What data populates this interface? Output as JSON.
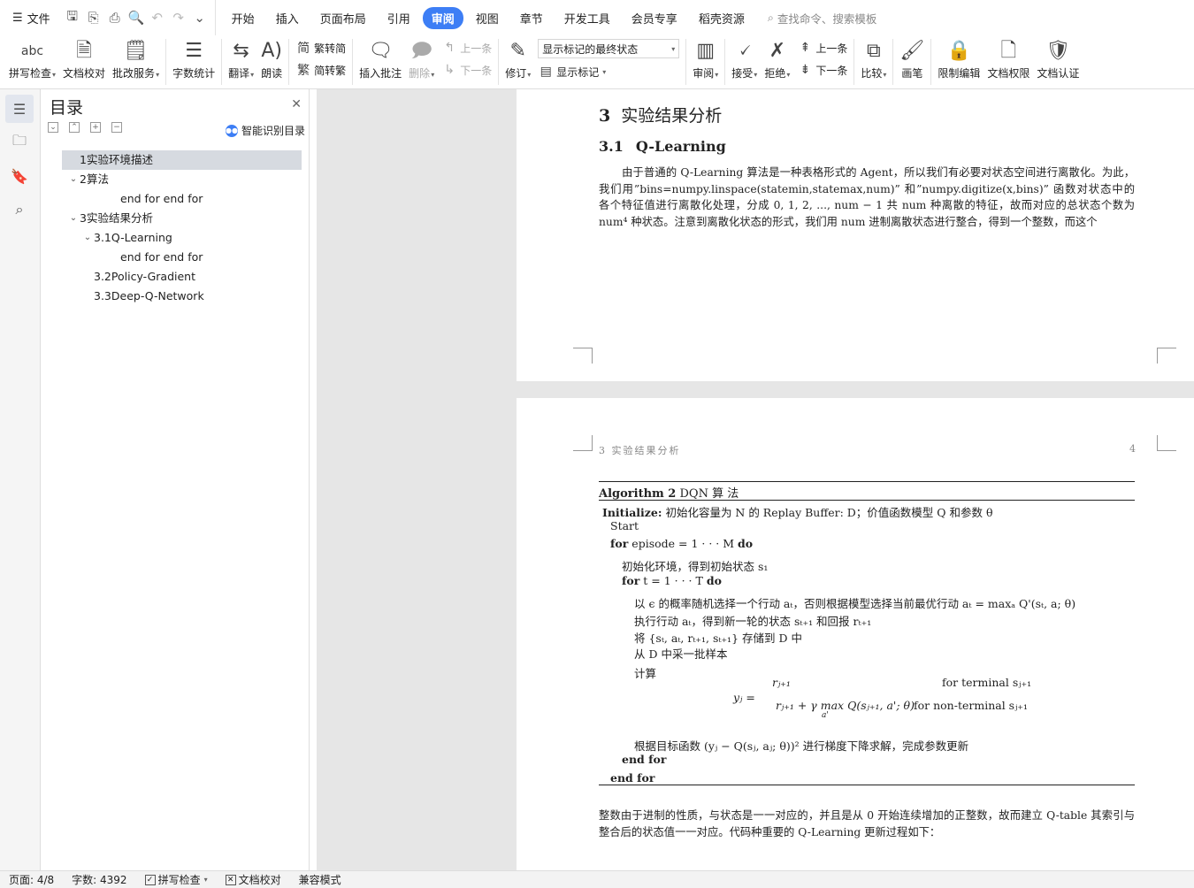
{
  "quick_access": {
    "file_label": "文件",
    "menu_icon": "hamburger-menu-icon"
  },
  "tabs": [
    {
      "label": "开始",
      "active": false
    },
    {
      "label": "插入",
      "active": false
    },
    {
      "label": "页面布局",
      "active": false
    },
    {
      "label": "引用",
      "active": false
    },
    {
      "label": "审阅",
      "active": true
    },
    {
      "label": "视图",
      "active": false
    },
    {
      "label": "章节",
      "active": false
    },
    {
      "label": "开发工具",
      "active": false
    },
    {
      "label": "会员专享",
      "active": false
    },
    {
      "label": "稻壳资源",
      "active": false
    }
  ],
  "command_search": {
    "placeholder": "查找命令、搜索模板"
  },
  "ribbon": {
    "spell_check": "拼写检查",
    "doc_proof": "文档校对",
    "correction_service": "批改服务",
    "word_count": "字数统计",
    "translate": "翻译",
    "read_aloud": "朗读",
    "trad_to_simp": "繁转简",
    "simp_to_trad": "简转繁",
    "insert_comment": "插入批注",
    "delete": "删除",
    "prev_comment": "上一条",
    "next_comment": "下一条",
    "revise": "修订",
    "markup_select": "显示标记的最终状态",
    "show_markup": "显示标记",
    "review": "审阅",
    "accept": "接受",
    "reject": "拒绝",
    "prev_change": "上一条",
    "next_change": "下一条",
    "compare": "比较",
    "brush": "画笔",
    "restrict_edit": "限制编辑",
    "doc_permission": "文档权限",
    "doc_certify": "文档认证",
    "abc_label": "abc"
  },
  "toc": {
    "title": "目录",
    "smart_label": "智能识别目录",
    "items": [
      {
        "label": "1实验环境描述",
        "level": 1,
        "selected": true,
        "expandable": false
      },
      {
        "label": "2算法",
        "level": 1,
        "selected": false,
        "expandable": true
      },
      {
        "label": "end for end for",
        "level": 3,
        "selected": false,
        "expandable": false
      },
      {
        "label": "3实验结果分析",
        "level": 1,
        "selected": false,
        "expandable": true
      },
      {
        "label": "3.1Q-Learning",
        "level": 2,
        "selected": false,
        "expandable": true
      },
      {
        "label": "end for end for",
        "level": 3,
        "selected": false,
        "expandable": false
      },
      {
        "label": "3.2Policy-Gradient",
        "level": 2,
        "selected": false,
        "expandable": false
      },
      {
        "label": "3.3Deep-Q-Network",
        "level": 2,
        "selected": false,
        "expandable": false
      }
    ]
  },
  "doc": {
    "page1": {
      "h1_num": "3",
      "h1_text": "实验结果分析",
      "h2_num": "3.1",
      "h2_text": "Q-Learning",
      "para": "由于普通的 Q-Learning 算法是一种表格形式的 Agent，所以我们有必要对状态空间进行离散化。为此，我们用”bins=numpy.linspace(statemin,statemax,num)” 和”numpy.digitize(x,bins)” 函数对状态中的各个特征值进行离散化处理，分成 0, 1, 2, ..., num − 1 共 num 种离散的特征，故而对应的总状态个数为 num⁴ 种状态。注意到离散化状态的形式，我们用 num 进制离散状态进行整合，得到一个整数，而这个"
    },
    "page2": {
      "header_left": "3 实验结果分析",
      "header_right": "4",
      "algo_title_bold": "Algorithm 2",
      "algo_title": "DQN 算 法",
      "lines": {
        "init_kw": "Initialize:",
        "init": "初始化容量为 N 的 Replay Buffer: D；价值函数模型 Q 和参数 θ",
        "start": "Start",
        "for_ep_kw": "for",
        "for_ep": "episode = 1 · · · M",
        "do1": "do",
        "init_state": "初始化环境，得到初始状态 s₁",
        "for_t_kw": "for",
        "for_t": "t = 1 · · · T",
        "do2": "do",
        "select": "以 ϵ 的概率随机选择一个行动 aₜ，否则根据模型选择当前最优行动 aₜ = maxₐ Q'(sₜ, a; θ)",
        "execute": "执行行动 aₜ，得到新一轮的状态 sₜ₊₁ 和回报 rₜ₊₁",
        "store": "将 {sₜ, aₜ, rₜ₊₁, sₜ₊₁} 存储到 D 中",
        "sample": "从 D 中采一批样本",
        "compute": "计算",
        "yj": "yⱼ =",
        "case1": "rⱼ₊₁",
        "case1_cond": "for terminal sⱼ₊₁",
        "case2": "rⱼ₊₁ + γ max Q(sⱼ₊₁, a'; θ)",
        "case2_sub": "a'",
        "case2_cond": "for non-terminal sⱼ₊₁",
        "update": "根据目标函数 (yⱼ − Q(sⱼ, aⱼ; θ))² 进行梯度下降求解，完成参数更新",
        "endfor_inner": "end for",
        "endfor_outer": "end for"
      },
      "para": "整数由于进制的性质，与状态是一一对应的，并且是从 0 开始连续增加的正整数，故而建立 Q-table 其索引与整合后的状态值一一对应。代码种重要的 Q-Learning 更新过程如下："
    }
  },
  "status": {
    "page": "页面: 4/8",
    "words": "字数: 4392",
    "spell": "拼写检查",
    "proof": "文档校对",
    "compat": "兼容模式"
  },
  "colors": {
    "accent": "#3d7ef5",
    "canvas_bg": "#e6e6e6",
    "toc_selected": "#d6dae0"
  }
}
